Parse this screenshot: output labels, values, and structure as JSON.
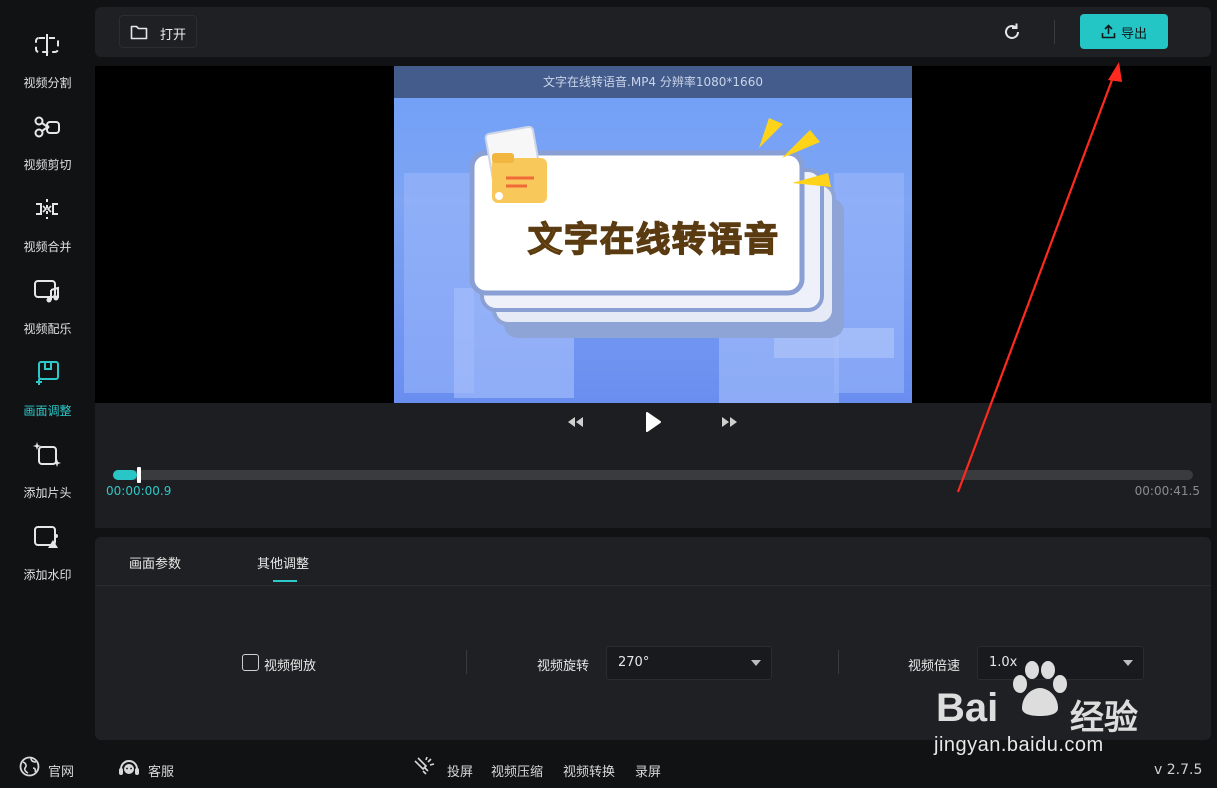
{
  "sidebar": {
    "items": [
      {
        "label": "视频分割",
        "icon": "split-icon"
      },
      {
        "label": "视频剪切",
        "icon": "scissors-icon"
      },
      {
        "label": "视频合并",
        "icon": "merge-icon"
      },
      {
        "label": "视频配乐",
        "icon": "music-icon"
      },
      {
        "label": "画面调整",
        "icon": "crop-icon",
        "active": true
      },
      {
        "label": "添加片头",
        "icon": "sparkle-frame-icon"
      },
      {
        "label": "添加水印",
        "icon": "image-watermark-icon"
      }
    ]
  },
  "toolbar": {
    "open_label": "打开",
    "export_label": "导出"
  },
  "preview": {
    "file_info": "文字在线转语音.MP4 分辨率1080*1660",
    "thumbnail_title": "文字在线转语音"
  },
  "playback": {
    "current_time": "00:00:00.9",
    "total_time": "00:00:41.5",
    "progress": 0.022
  },
  "settings": {
    "tabs": [
      {
        "label": "画面参数"
      },
      {
        "label": "其他调整",
        "active": true
      }
    ],
    "reverse_label": "视频倒放",
    "reverse_checked": false,
    "rotate_label": "视频旋转",
    "rotate_value": "270°",
    "speed_label": "视频倍速",
    "speed_value": "1.0x"
  },
  "footer": {
    "site_label": "官网",
    "support_label": "客服",
    "cast_label": "投屏",
    "compress_label": "视频压缩",
    "convert_label": "视频转换",
    "record_label": "录屏",
    "version": "v 2.7.5"
  },
  "watermark": {
    "brand": "Bai",
    "brand_cn": "经验",
    "url": "jingyan.baidu.com"
  },
  "colors": {
    "accent": "#24c5c5",
    "annotation_arrow": "#ff2a1f",
    "thumbnail_title": "#ffd31a"
  }
}
